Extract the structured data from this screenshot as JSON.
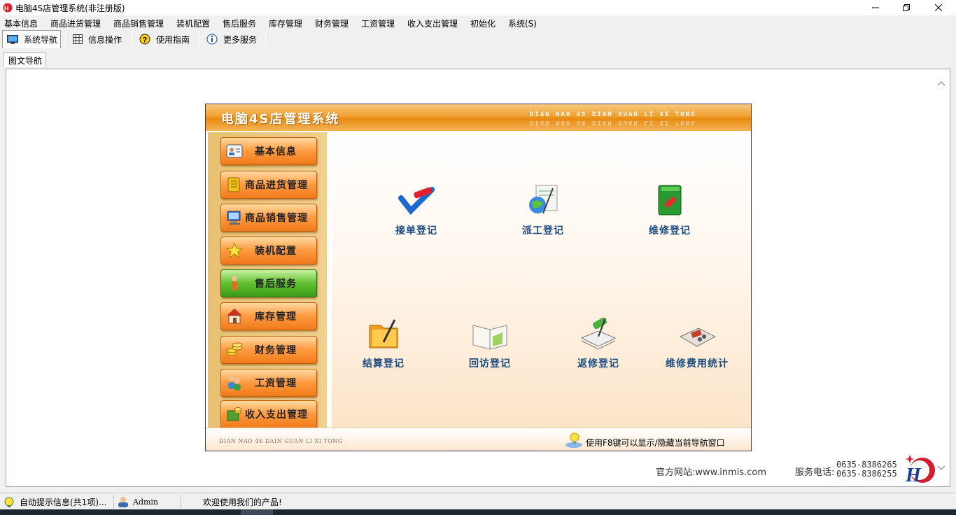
{
  "window": {
    "title": "电脑4S店管理系统(非注册版)"
  },
  "menu": [
    "基本信息",
    "商品进货管理",
    "商品销售管理",
    "装机配置",
    "售后服务",
    "库存管理",
    "财务管理",
    "工资管理",
    "收入支出管理",
    "初始化",
    "系统(S)"
  ],
  "toolbar": [
    {
      "label": "系统导航",
      "icon": "monitor-icon"
    },
    {
      "label": "信息操作",
      "icon": "grid-icon"
    },
    {
      "label": "使用指南",
      "icon": "help-icon"
    },
    {
      "label": "更多服务",
      "icon": "info-icon"
    }
  ],
  "tab": {
    "label": "图文导航"
  },
  "nav": {
    "title": "电脑4S店管理系统",
    "pinyin": "DIAN NAO 4S DIAN GUAN LI XI TONG",
    "sidebar": [
      {
        "label": "基本信息",
        "icon": "contact-card-icon"
      },
      {
        "label": "商品进货管理",
        "icon": "ledger-icon"
      },
      {
        "label": "商品销售管理",
        "icon": "computer-icon"
      },
      {
        "label": "装机配置",
        "icon": "star-icon"
      },
      {
        "label": "售后服务",
        "icon": "person-icon",
        "active": true
      },
      {
        "label": "库存管理",
        "icon": "house-icon"
      },
      {
        "label": "财务管理",
        "icon": "coins-icon"
      },
      {
        "label": "工资管理",
        "icon": "users-icon"
      },
      {
        "label": "收入支出管理",
        "icon": "money-icon"
      }
    ],
    "functions": [
      {
        "label": "接单登记",
        "icon": "order-pen-icon"
      },
      {
        "label": "派工登记",
        "icon": "globe-doc-icon"
      },
      {
        "label": "维修登记",
        "icon": "green-book-icon"
      },
      {
        "label": "结算登记",
        "icon": "folder-pen-icon"
      },
      {
        "label": "回访登记",
        "icon": "open-book-icon"
      },
      {
        "label": "返修登记",
        "icon": "notepad-icon"
      },
      {
        "label": "维修费用统计",
        "icon": "calculator-icon"
      }
    ],
    "footer_pinyin": "DIAN NAO 4S DAIN GUAN LI XI TONG",
    "footer_hint": "使用F8键可以显示/隐藏当前导航窗口"
  },
  "site": "官方网站:www.inmis.com",
  "service_label": "服务电话:",
  "phones": [
    "0635-8386265",
    "0635-8386255"
  ],
  "status": {
    "tips": "自动提示信息(共1项)...",
    "user": "Admin",
    "welcome": "欢迎使用我们的产品!"
  }
}
